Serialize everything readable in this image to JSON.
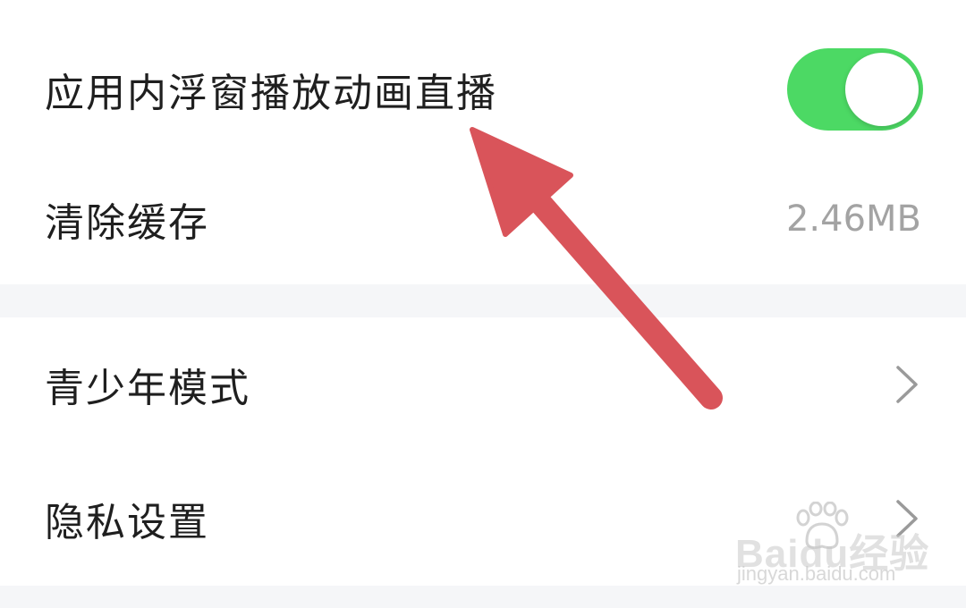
{
  "settings": {
    "float_window": {
      "label": "应用内浮窗播放动画直播",
      "enabled": true
    },
    "clear_cache": {
      "label": "清除缓存",
      "value": "2.46MB"
    },
    "teen_mode": {
      "label": "青少年模式"
    },
    "privacy": {
      "label": "隐私设置"
    }
  },
  "watermark": {
    "brand": "Baidu经验",
    "url": "jingyan.baidu.com"
  },
  "colors": {
    "toggle_on": "#4cd964",
    "arrow": "#d9545a",
    "section_gap": "#f5f6f8",
    "value_text": "#a3a3a3"
  },
  "icons": {
    "chevron": "chevron-right-icon",
    "annotation": "red-arrow-annotation",
    "paw": "baidu-paw-icon"
  }
}
